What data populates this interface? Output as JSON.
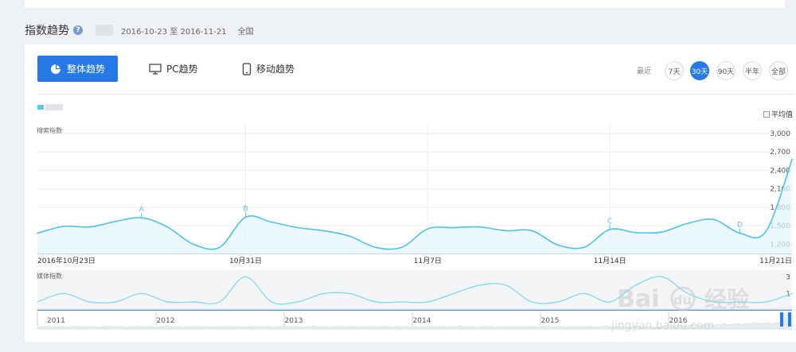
{
  "header": {
    "title": "指数趋势",
    "date_range": "2016-10-23 至 2016-11-21",
    "region": "全国"
  },
  "tabs": [
    {
      "label": "整体趋势",
      "active": true,
      "icon": "pie-icon"
    },
    {
      "label": "PC趋势",
      "active": false,
      "icon": "monitor-icon"
    },
    {
      "label": "移动趋势",
      "active": false,
      "icon": "phone-icon"
    }
  ],
  "range": {
    "label": "最近",
    "options": [
      "7天",
      "30天",
      "90天",
      "半年",
      "全部"
    ],
    "selected": "30天"
  },
  "avg_label": "平均值",
  "watermark": {
    "brand": "Baidu经验",
    "url": "jingyan.baidu.com"
  },
  "colors": {
    "accent": "#2779e8",
    "line": "#4cc3ee",
    "fill": "#e3f5fc"
  },
  "chart_data": [
    {
      "type": "area",
      "ylabel": "搜索指数",
      "ylim": [
        1050,
        3000
      ],
      "yticks": [
        1200,
        1500,
        1800,
        2100,
        2400,
        2700,
        3000
      ],
      "ytick_labels": [
        "1,200",
        "1,500",
        "1,800",
        "2,100",
        "2,400",
        "2,700",
        "3,000"
      ],
      "x": [
        "2016-10-23",
        "2016-10-24",
        "2016-10-25",
        "2016-10-26",
        "2016-10-27",
        "2016-10-28",
        "2016-10-29",
        "2016-10-30",
        "2016-10-31",
        "2016-11-01",
        "2016-11-02",
        "2016-11-03",
        "2016-11-04",
        "2016-11-05",
        "2016-11-06",
        "2016-11-07",
        "2016-11-08",
        "2016-11-09",
        "2016-11-10",
        "2016-11-11",
        "2016-11-12",
        "2016-11-13",
        "2016-11-14",
        "2016-11-15",
        "2016-11-16",
        "2016-11-17",
        "2016-11-18",
        "2016-11-19",
        "2016-11-20",
        "2016-11-21"
      ],
      "xtick_labels": [
        {
          "date": "2016-10-23",
          "label": "2016年10月23日"
        },
        {
          "date": "2016-10-31",
          "label": "10月31日"
        },
        {
          "date": "2016-11-07",
          "label": "11月7日"
        },
        {
          "date": "2016-11-14",
          "label": "11月14日"
        },
        {
          "date": "2016-11-21",
          "label": "11月21日"
        }
      ],
      "values": [
        1380,
        1490,
        1480,
        1570,
        1630,
        1480,
        1200,
        1150,
        1640,
        1560,
        1470,
        1420,
        1330,
        1150,
        1150,
        1450,
        1470,
        1480,
        1420,
        1420,
        1190,
        1150,
        1440,
        1390,
        1400,
        1540,
        1600,
        1380,
        1410,
        2580
      ],
      "annotations": [
        {
          "date": "2016-10-27",
          "label": "A"
        },
        {
          "date": "2016-10-31",
          "label": "B"
        },
        {
          "date": "2016-11-14",
          "label": "C"
        },
        {
          "date": "2016-11-19",
          "label": "D"
        }
      ]
    },
    {
      "type": "line",
      "ylabel": "媒体指数",
      "ylim": [
        0,
        3.5
      ],
      "yticks": [
        1,
        3
      ],
      "ytick_labels": [
        "1",
        "3"
      ],
      "x": [
        "2016-10-23",
        "2016-10-24",
        "2016-10-25",
        "2016-10-26",
        "2016-10-27",
        "2016-10-28",
        "2016-10-29",
        "2016-10-30",
        "2016-10-31",
        "2016-11-01",
        "2016-11-02",
        "2016-11-03",
        "2016-11-04",
        "2016-11-05",
        "2016-11-06",
        "2016-11-07",
        "2016-11-08",
        "2016-11-09",
        "2016-11-10",
        "2016-11-11",
        "2016-11-12",
        "2016-11-13",
        "2016-11-14",
        "2016-11-15",
        "2016-11-16",
        "2016-11-17",
        "2016-11-18",
        "2016-11-19",
        "2016-11-20",
        "2016-11-21"
      ],
      "values": [
        0,
        1,
        0,
        0,
        1,
        0,
        0,
        0,
        3,
        0,
        0,
        1,
        1,
        0,
        0,
        0,
        1,
        2,
        2,
        0,
        0,
        1,
        0,
        2,
        3,
        1,
        0,
        0,
        0,
        1
      ]
    },
    {
      "type": "area",
      "x_years": [
        "2011",
        "2012",
        "2013",
        "2014",
        "2015",
        "2016"
      ]
    }
  ]
}
